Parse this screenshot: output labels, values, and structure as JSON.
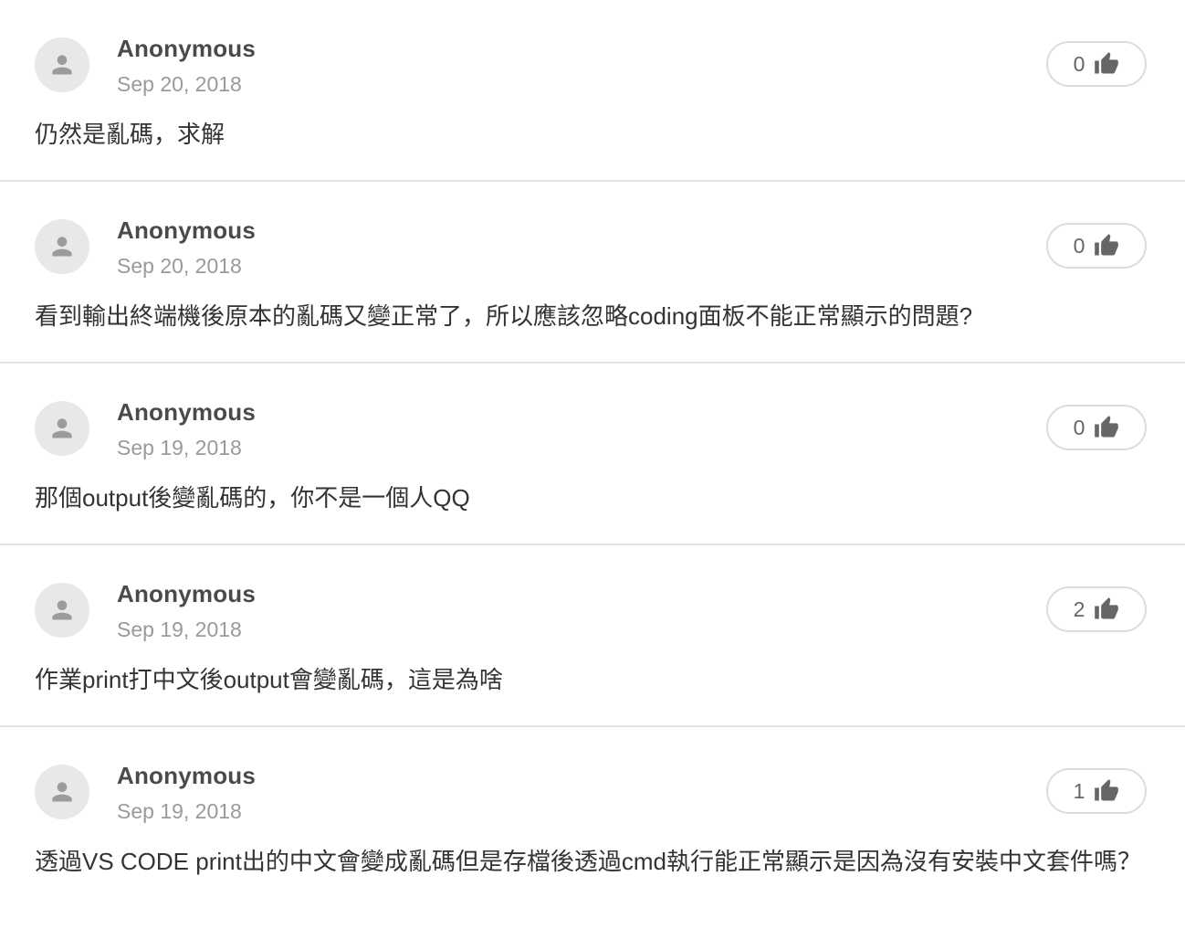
{
  "comments": [
    {
      "author": "Anonymous",
      "date": "Sep 20, 2018",
      "likes": "0",
      "text": "仍然是亂碼，求解"
    },
    {
      "author": "Anonymous",
      "date": "Sep 20, 2018",
      "likes": "0",
      "text": "看到輸出終端機後原本的亂碼又變正常了，所以應該忽略coding面板不能正常顯示的問題?"
    },
    {
      "author": "Anonymous",
      "date": "Sep 19, 2018",
      "likes": "0",
      "text": "那個output後變亂碼的，你不是一個人QQ"
    },
    {
      "author": "Anonymous",
      "date": "Sep 19, 2018",
      "likes": "2",
      "text": "作業print打中文後output會變亂碼，這是為啥"
    },
    {
      "author": "Anonymous",
      "date": "Sep 19, 2018",
      "likes": "1",
      "text": "透過VS CODE print出的中文會變成亂碼但是存檔後透過cmd執行能正常顯示是因為沒有安裝中文套件嗎？"
    }
  ],
  "icons": {
    "avatar": "person-icon",
    "like": "thumbs-up-icon"
  },
  "colors": {
    "avatar_bg": "#e8e8e8",
    "avatar_fg": "#9b9b9b",
    "author": "#4a4a4a",
    "date": "#9a9a9a",
    "body": "#333333",
    "divider": "#e3e3e3",
    "like_border": "#dcdcdc",
    "like_icon": "#666666"
  }
}
